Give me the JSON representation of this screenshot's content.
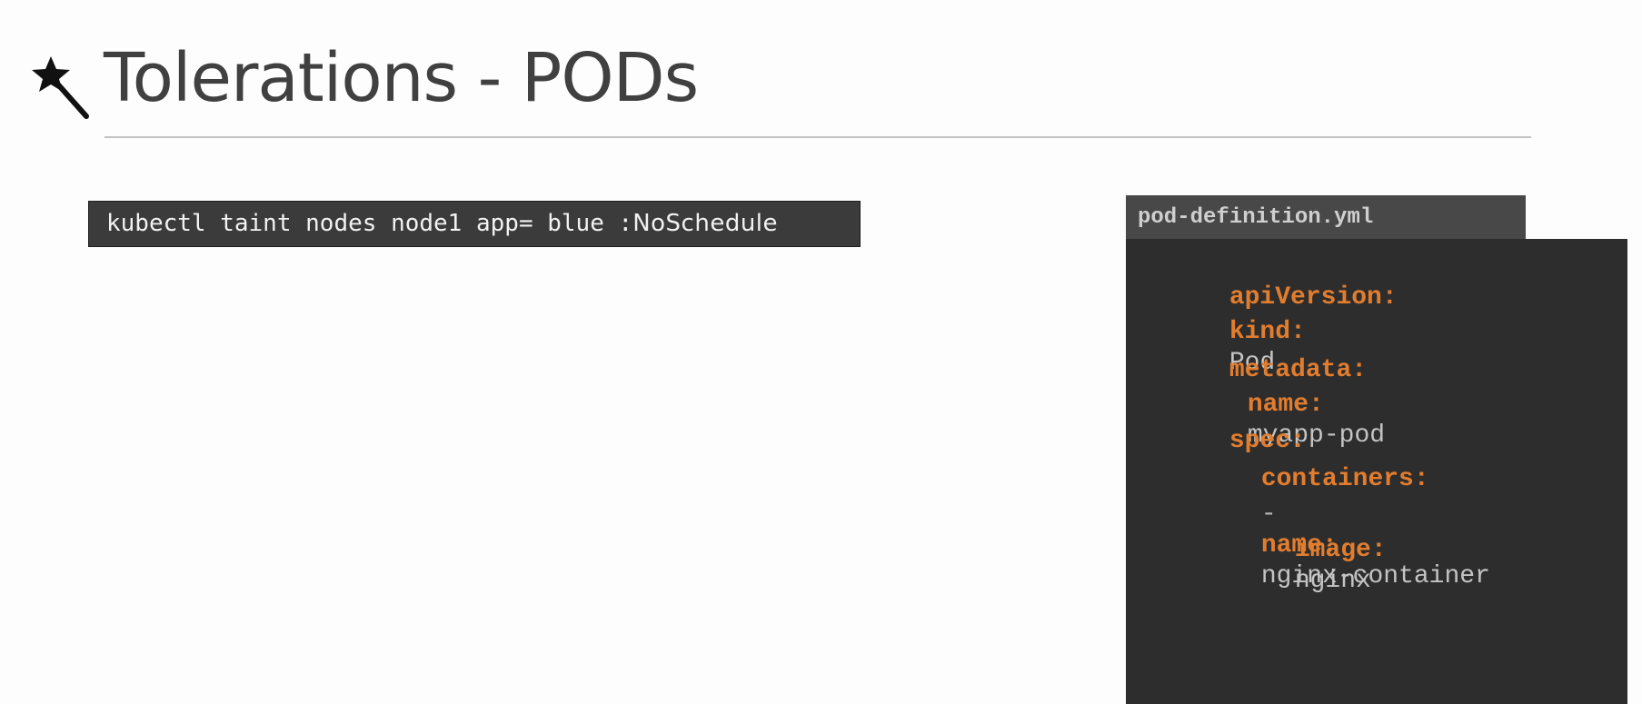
{
  "slide": {
    "title": "Tolerations - PODs",
    "title_icon": "magic-wand-icon"
  },
  "command": {
    "prefix": "kubectl taint nodes node1 app= blue :",
    "effect": "NoSchedule"
  },
  "code_file": {
    "filename": "pod-definition.yml",
    "lines": {
      "api_version_key": "apiVersion:",
      "kind_key": "kind:",
      "kind_value": "Pod",
      "metadata_key": "metadata:",
      "name_key": "name:",
      "name_value": "myapp-pod",
      "spec_key": "spec:",
      "containers_key": "containers:",
      "dash": "-",
      "container_name_key": "name:",
      "container_name_value": "nginx-container",
      "image_key": "image:",
      "image_value": "nginx"
    }
  },
  "colors": {
    "yaml_key": "#e27d2e",
    "yaml_value": "#c4c4c4",
    "code_background": "#2d2d2d",
    "tab_background": "#484848",
    "command_background": "#3b3b3b",
    "title_text": "#404040"
  }
}
